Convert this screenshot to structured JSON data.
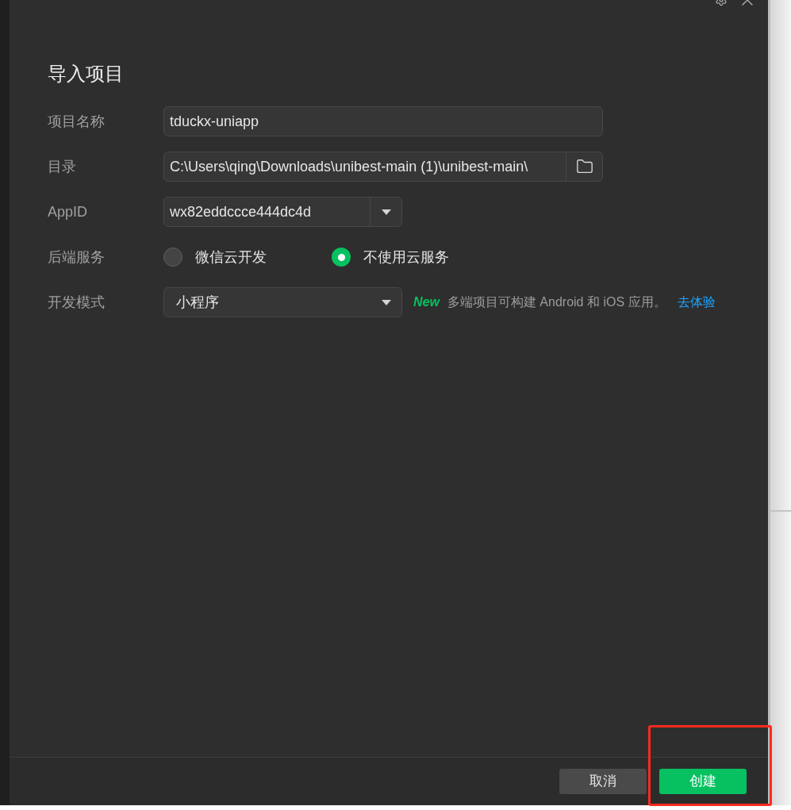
{
  "window": {
    "title": "导入项目",
    "controls": [
      {
        "kind": "settings"
      },
      {
        "kind": "close"
      }
    ]
  },
  "form": {
    "fields": [
      {
        "kind": "text",
        "label": "项目名称",
        "value": "tduckx-uniapp"
      },
      {
        "kind": "path",
        "label": "目录",
        "value": "C:\\Users\\qing\\Downloads\\unibest-main (1)\\unibest-main\\"
      },
      {
        "kind": "combobox",
        "label": "AppID",
        "value": "wx82eddccce444dc4d"
      },
      {
        "kind": "radio",
        "label": "后端服务",
        "options": [
          {
            "label": "微信云开发",
            "selected": false
          },
          {
            "label": "不使用云服务",
            "selected": true
          }
        ]
      },
      {
        "kind": "select",
        "label": "开发模式",
        "value": "小程序",
        "note": {
          "badge": "New",
          "text": "多端项目可构建 Android 和 iOS 应用。",
          "link": "去体验"
        }
      }
    ]
  },
  "buttons": [
    {
      "kind": "secondary",
      "label": "取消",
      "highlighted": false
    },
    {
      "kind": "primary",
      "label": "创建",
      "highlighted": true
    }
  ]
}
